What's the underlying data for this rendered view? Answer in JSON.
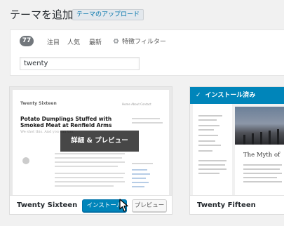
{
  "header": {
    "title": "テーマを追加",
    "upload_label": "テーマのアップロード"
  },
  "filters": {
    "count": "77",
    "tabs": [
      "注目",
      "人気",
      "最新"
    ],
    "feature_filter_label": "特徴フィルター",
    "feature_filter_icon": "gear-icon"
  },
  "search": {
    "value": "twenty"
  },
  "themes": [
    {
      "name": "Twenty Sixteen",
      "overlay_label": "詳細 & プレビュー",
      "install_label": "インストール",
      "preview_label": "プレビュー",
      "screenshot": {
        "site_title": "Twenty Sixteen",
        "post_title": "Potato Dumplings Stuffed with Smoked Meat at Renfield Arms",
        "post_subtitle": "We shot this. And you can too."
      }
    },
    {
      "name": "Twenty Fifteen",
      "installed_label": "インストール済み",
      "installed_icon": "check-icon",
      "screenshot": {
        "post_title": "The Myth of"
      }
    }
  ],
  "colors": {
    "primary_button": "#0085ba",
    "installed_banner": "#0085ba",
    "badge": "#72777c"
  }
}
